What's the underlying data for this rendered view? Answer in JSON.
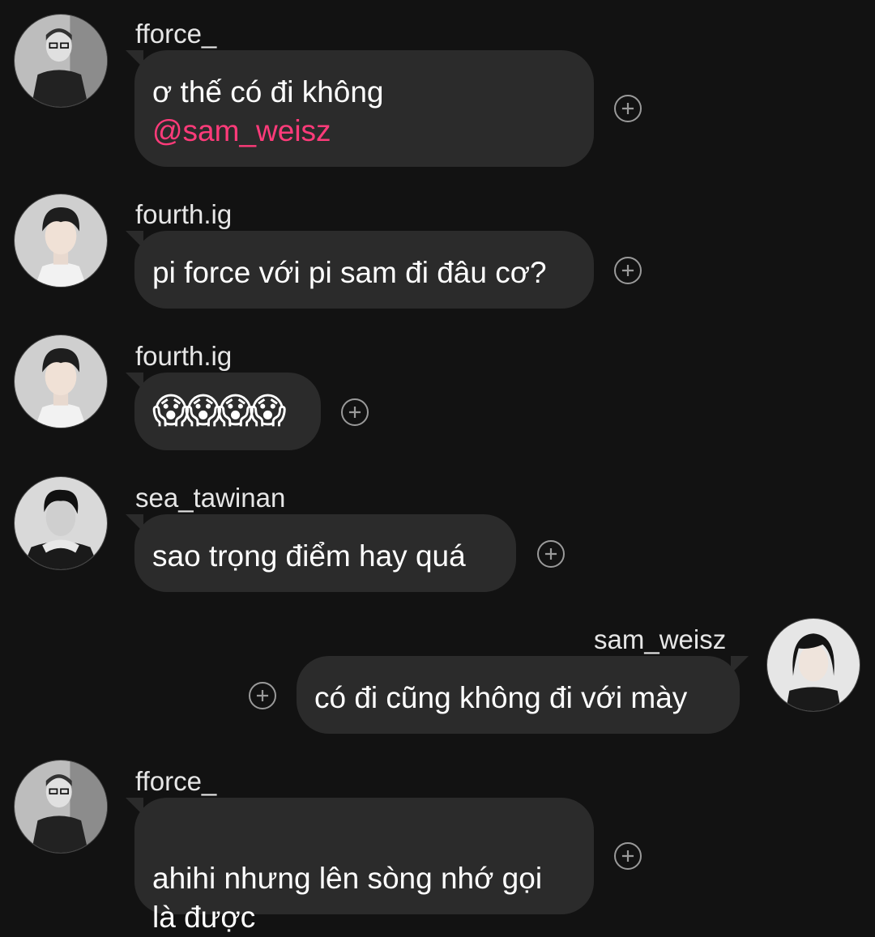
{
  "messages": [
    {
      "username": "fforce_",
      "text": "ơ thế có đi không",
      "mention": "@sam_weisz"
    },
    {
      "username": "fourth.ig",
      "text": "pi force với pi sam đi đâu cơ?"
    },
    {
      "username": "fourth.ig",
      "text": "😱😱😱😱"
    },
    {
      "username": "sea_tawinan",
      "text": "sao trọng điểm hay quá"
    },
    {
      "username": "sam_weisz",
      "text": "có đi cũng không đi với mày"
    },
    {
      "username": "fforce_",
      "text": "ahihi nhưng lên sòng nhớ gọi\nlà được"
    }
  ],
  "icons": {
    "react": "add-reaction-icon"
  },
  "colors": {
    "background": "#121212",
    "bubble": "#2b2b2b",
    "mention": "#ff3b7a"
  }
}
